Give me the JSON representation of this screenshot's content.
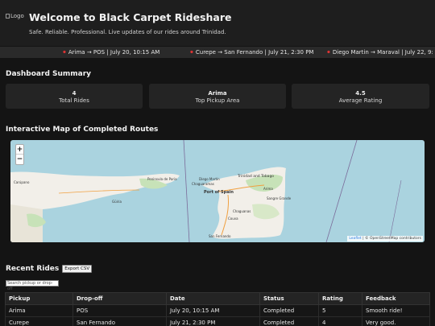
{
  "header": {
    "logo_alt": "Logo",
    "title": "Welcome to Black Carpet Rideshare",
    "subtitle": "Safe. Reliable. Professional. Live updates of our rides around Trinidad."
  },
  "ticker": [
    {
      "icon": "car-icon",
      "text": "Arima → POS | July 20, 10:15 AM"
    },
    {
      "icon": "car-icon",
      "text": "Curepe → San Fernando | July 21, 2:30 PM"
    },
    {
      "icon": "car-icon",
      "text": "Diego Martin → Maraval | July 22, 9:"
    }
  ],
  "dashboard": {
    "title": "Dashboard Summary",
    "cards": [
      {
        "value": "4",
        "label": "Total Rides"
      },
      {
        "value": "Arima",
        "label": "Top Pickup Area"
      },
      {
        "value": "4.5",
        "label": "Average Rating"
      }
    ]
  },
  "map": {
    "title": "Interactive Map of Completed Routes",
    "zoom_in": "+",
    "zoom_out": "−",
    "attribution_leaflet": "Leaflet",
    "attribution_rest": "| © OpenStreetMap contributors",
    "place_labels": [
      "Trinidad and Tobago",
      "Port of Spain",
      "Arima",
      "San Fernando",
      "Güiria",
      "Peninsula de Paria",
      "Chaguaramas",
      "Diego Martin",
      "Sangre Grande",
      "Couva",
      "Chaguanas",
      "Carúpano"
    ]
  },
  "rides": {
    "title": "Recent Rides",
    "export_label": "Export CSV",
    "search_placeholder": "Search pickup or drop-off",
    "columns": [
      "Pickup",
      "Drop-off",
      "Date",
      "Status",
      "Rating",
      "Feedback"
    ],
    "rows": [
      [
        "Arima",
        "POS",
        "July 20, 10:15 AM",
        "Completed",
        "5",
        "Smooth ride!"
      ],
      [
        "Curepe",
        "San Fernando",
        "July 21, 2:30 PM",
        "Completed",
        "4",
        "Very good."
      ]
    ]
  },
  "colors": {
    "background": "#141414",
    "header": "#1e1e1e",
    "card": "#242424",
    "water": "#aad3df",
    "land": "#f2efe9",
    "accent": "#d33333"
  }
}
